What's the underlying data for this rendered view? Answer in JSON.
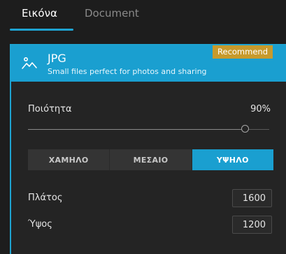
{
  "tabs": [
    {
      "label": "Εικόνα",
      "active": true
    },
    {
      "label": "Document",
      "active": false
    }
  ],
  "format": {
    "name": "JPG",
    "description": "Small files perfect for photos and sharing",
    "badge": "Recommend",
    "icon": "image-mountain-icon"
  },
  "quality": {
    "label": "Ποιότητα",
    "value_text": "90%",
    "value": 90,
    "min": 0,
    "max": 100
  },
  "presets": {
    "options": [
      "ΧΑΜΗΛΟ",
      "ΜΕΣΑΙΟ",
      "ΥΨΗΛΟ"
    ],
    "selected": "ΥΨΗΛΟ"
  },
  "width": {
    "label": "Πλάτος",
    "value": "1600"
  },
  "height": {
    "label": "Ύψος",
    "value": "1200"
  },
  "colors": {
    "accent": "#1a9fd0",
    "badge": "#c79a2c",
    "background": "#1d1d1d",
    "panel": "#242424"
  }
}
